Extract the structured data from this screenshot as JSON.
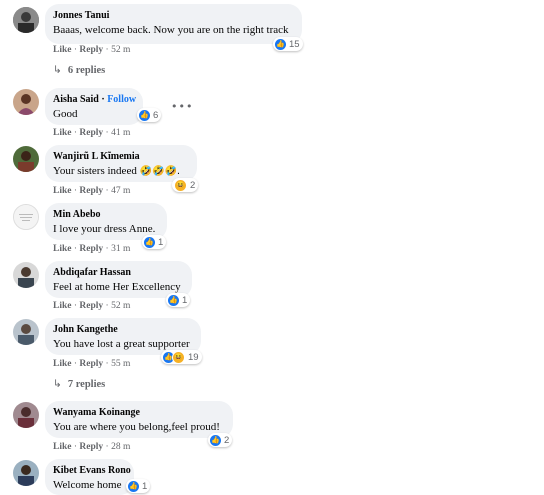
{
  "comments": [
    {
      "name": "Jonnes Tanui",
      "text": "Baaas, welcome back. Now you are on the right track",
      "like": "Like",
      "reply": "Reply",
      "time": "52 m",
      "reactions": "15",
      "replies": "6 replies"
    },
    {
      "name": "Aisha Said",
      "follow": "Follow",
      "text": "Good",
      "like": "Like",
      "reply": "Reply",
      "time": "41 m",
      "reactions": "6",
      "more": "•••"
    },
    {
      "name": "Wanjirũ L Kĩmemia",
      "text": "Your sisters indeed",
      "emoji": "🤣🤣🤣.",
      "like": "Like",
      "reply": "Reply",
      "time": "47 m",
      "reactions": "2"
    },
    {
      "name": "Min Abebo",
      "text": "I love your dress Anne.",
      "like": "Like",
      "reply": "Reply",
      "time": "31 m",
      "reactions": "1"
    },
    {
      "name": "Abdiqafar Hassan",
      "text": "Feel at home Her Excellency",
      "like": "Like",
      "reply": "Reply",
      "time": "52 m",
      "reactions": "1"
    },
    {
      "name": "John Kangethe",
      "text": "You have lost a great supporter",
      "like": "Like",
      "reply": "Reply",
      "time": "55 m",
      "reactions": "19",
      "replies": "7 replies"
    },
    {
      "name": "Wanyama Koinange",
      "text": "You are where you belong,feel proud!",
      "like": "Like",
      "reply": "Reply",
      "time": "28 m",
      "reactions": "2"
    },
    {
      "name": "Kibet Evans Rono",
      "text": "Welcome home",
      "reactions": "1"
    }
  ],
  "colors": {
    "accent": "#1877f2",
    "bubble": "#f0f2f5",
    "meta": "#65676b"
  },
  "icons": {
    "like": "thumbs-up-icon",
    "haha": "laughing-face-icon",
    "reply_arrow": "reply-arrow-icon",
    "more": "more-dots-icon"
  }
}
